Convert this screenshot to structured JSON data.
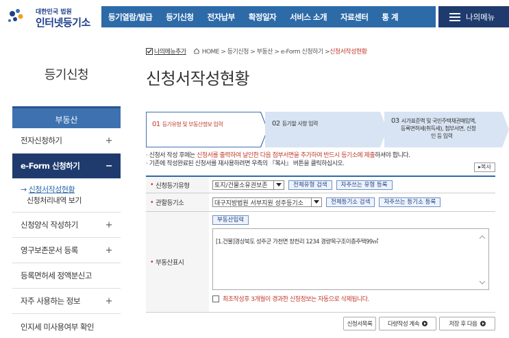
{
  "header": {
    "logo_small": "대한민국 법원",
    "logo_big": "인터넷등기소",
    "gnb": [
      "등기열람/발급",
      "등기신청",
      "전자납부",
      "확정일자",
      "서비스 소개",
      "자료센터",
      "통 계"
    ],
    "my_menu": "나의메뉴"
  },
  "breadcrumb": {
    "favorite": "나의메뉴추가",
    "path": "HOME > 등기신청 > 부동산 > e-Form 신청하기 > ",
    "current": "신청서작성현황"
  },
  "sidebar": {
    "title": "등기신청",
    "head": "부동산",
    "items": [
      {
        "label": "전자신청하기",
        "mark": "+"
      },
      {
        "label": "e-Form 신청하기",
        "mark": "−"
      },
      {
        "label": "신청양식 작성하기",
        "mark": "+"
      },
      {
        "label": "영구보존문서 등록",
        "mark": "+"
      },
      {
        "label": "등록면허세 정액분신고",
        "mark": ""
      },
      {
        "label": "자주 사용하는 정보",
        "mark": "+"
      },
      {
        "label": "인지세 미사용여부 확인",
        "mark": ""
      }
    ],
    "sub": [
      "신청서작성현황",
      "신청처리내역 보기"
    ]
  },
  "page": {
    "title": "신청서작성현황"
  },
  "steps": [
    {
      "num": "01",
      "label": "등기유형 및 부동산정보 입력"
    },
    {
      "num": "02",
      "label": "등기할 사항 입력"
    },
    {
      "num": "03",
      "label1": "시가표준액 및 국민주택채권매입액,",
      "label2": "등록면허세(취득세), 첨부서면, 신청",
      "label3": "인 등 입력"
    }
  ],
  "notes": {
    "line1_a": "· 신청서 작성 후에는 ",
    "line1_b": "신청서를 출력하여 날인한 다음 첨부서면을 추가하여 반드시 등기소에 제출",
    "line1_c": "하셔야 합니다.",
    "line2": "· 기존에 작성완료된 신청서를 재사용하려면 우측의 『복사』 버튼을 클릭하십시오.",
    "copy_button": "▸복사"
  },
  "form": {
    "type_label": "신청등기유형",
    "type_value": "토지/건물소유권보존",
    "type_btn1": "전체유형 검색",
    "type_btn2": "자주쓰는 유형 등록",
    "office_label": "관할등기소",
    "office_value": "대구지방법원 서부지원 성주등기소",
    "office_btn1": "전체등기소 검색",
    "office_btn2": "자주쓰는 등기소 등록",
    "property_label": "부동산표시",
    "property_btn": "부동산입력",
    "property_text": "[1.건물]경상북도 성주군 가천면 창천리 1234 경량목구조이층주택99㎡",
    "delete_notice": "최초작성후 3개월이 경과한 신청정보는 자동으로 삭제됩니다."
  },
  "bottom": {
    "list": "신청서목록",
    "next": "다량작성 계속",
    "save": "저장 후 다음"
  },
  "colors": {
    "brand": "#2d6aa8",
    "dark": "#1f3b6e",
    "alert": "#c0392b"
  }
}
